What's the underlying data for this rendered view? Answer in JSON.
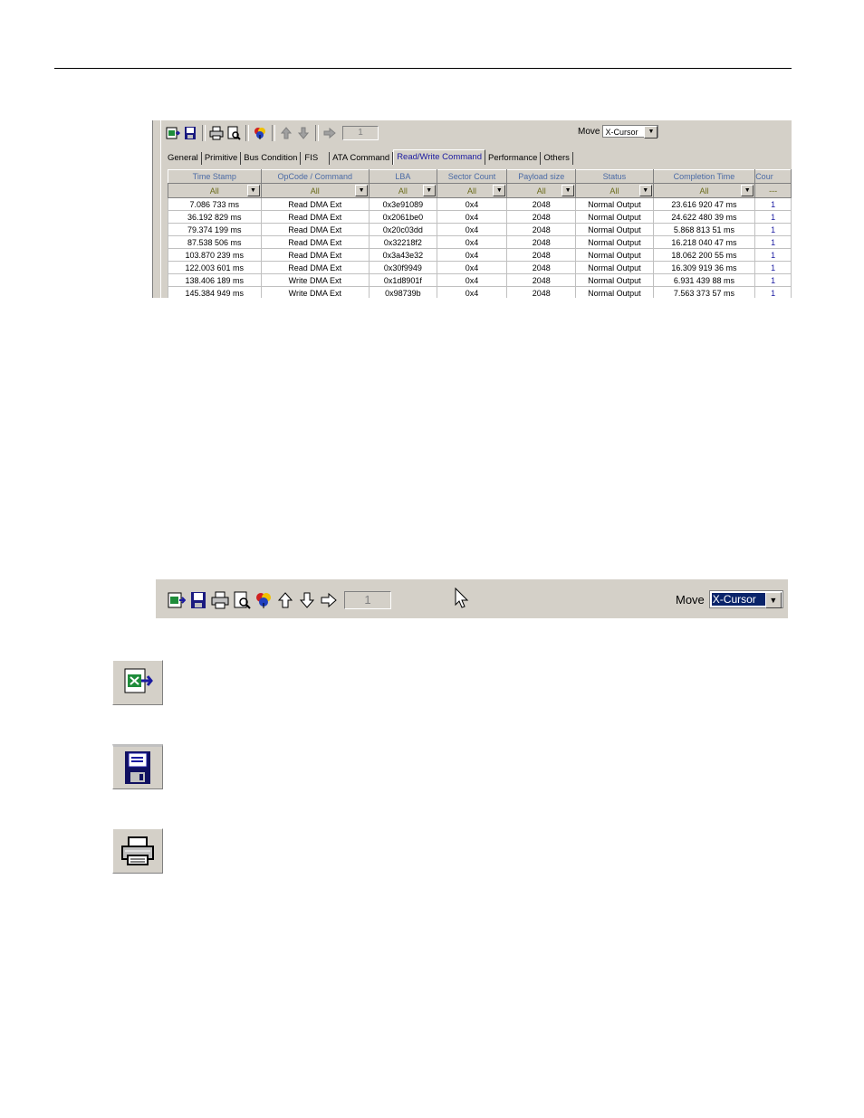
{
  "toolbar": {
    "goto_value": "1",
    "move_label": "Move",
    "move_value": "X-Cursor"
  },
  "tabs": [
    "General",
    "Primitive",
    "Bus Condition",
    "FIS",
    "ATA Command",
    "Read/Write Command",
    "Performance",
    "Others"
  ],
  "active_tab": "Read/Write Command",
  "table": {
    "columns": [
      "Time Stamp",
      "OpCode / Command",
      "LBA",
      "Sector Count",
      "Payload size",
      "Status",
      "Completion Time",
      "Cour"
    ],
    "filters": [
      "All",
      "All",
      "All",
      "All",
      "All",
      "All",
      "All",
      "---"
    ],
    "rows": [
      [
        "7.086 733  ms",
        "Read DMA Ext",
        "0x3e91089",
        "0x4",
        "2048",
        "Normal Output",
        "23.616 920 47  ms",
        "1"
      ],
      [
        "36.192 829  ms",
        "Read DMA Ext",
        "0x2061be0",
        "0x4",
        "2048",
        "Normal Output",
        "24.622 480 39  ms",
        "1"
      ],
      [
        "79.374 199  ms",
        "Read DMA Ext",
        "0x20c03dd",
        "0x4",
        "2048",
        "Normal Output",
        "5.868 813 51  ms",
        "1"
      ],
      [
        "87.538 506  ms",
        "Read DMA Ext",
        "0x32218f2",
        "0x4",
        "2048",
        "Normal Output",
        "16.218 040 47  ms",
        "1"
      ],
      [
        "103.870 239  ms",
        "Read DMA Ext",
        "0x3a43e32",
        "0x4",
        "2048",
        "Normal Output",
        "18.062 200 55  ms",
        "1"
      ],
      [
        "122.003 601  ms",
        "Read DMA Ext",
        "0x30f9949",
        "0x4",
        "2048",
        "Normal Output",
        "16.309 919 36  ms",
        "1"
      ],
      [
        "138.406 189  ms",
        "Write DMA Ext",
        "0x1d8901f",
        "0x4",
        "2048",
        "Normal Output",
        "6.931 439 88  ms",
        "1"
      ],
      [
        "145.384 949  ms",
        "Write DMA Ext",
        "0x98739b",
        "0x4",
        "2048",
        "Normal Output",
        "7.563 373 57  ms",
        "1"
      ]
    ]
  },
  "icons": {
    "export": "export-to-excel-icon",
    "save": "save-icon",
    "print": "print-icon",
    "preview": "print-preview-icon",
    "color": "color-palette-icon",
    "up": "arrow-up-icon",
    "down": "arrow-down-icon",
    "goto": "arrow-right-icon"
  },
  "colors": {
    "panel": "#d4d0c8",
    "header_text": "#4a6aa5",
    "filter_text": "#6b6b1a",
    "highlight": "#0a246a"
  }
}
